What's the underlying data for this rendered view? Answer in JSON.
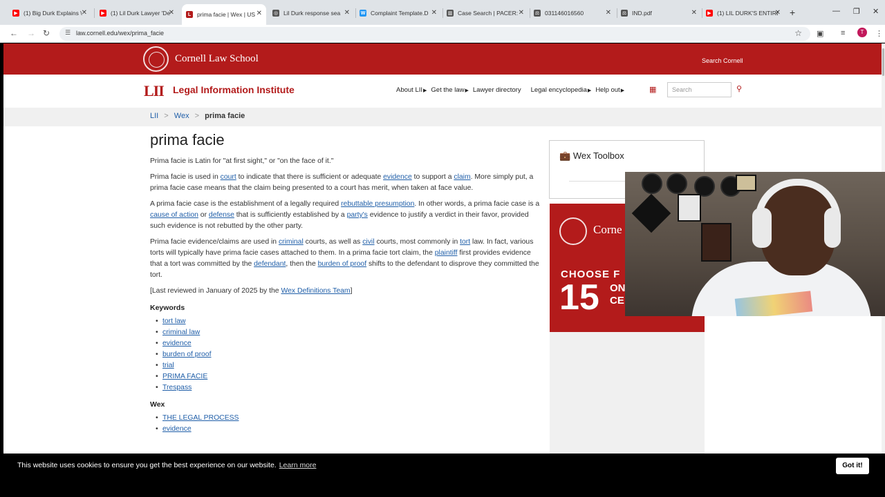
{
  "browser": {
    "tabs": [
      {
        "title": "(1) Big Durk Explains \\",
        "favicon_color": "#ff0000"
      },
      {
        "title": "(1) Lil Durk Lawyer 'De",
        "favicon_color": "#ff0000"
      },
      {
        "title": "prima facie | Wex | US",
        "favicon_color": "#b31b1b"
      },
      {
        "title": "Lil Durk response sea",
        "favicon_color": "#555555"
      },
      {
        "title": "Complaint Template.D",
        "favicon_color": "#2196f3"
      },
      {
        "title": "Case Search | PACER:",
        "favicon_color": "#555555"
      },
      {
        "title": "031146016560",
        "favicon_color": "#555555"
      },
      {
        "title": "IND.pdf",
        "favicon_color": "#555555"
      },
      {
        "title": "(1) LIL DURK'S ENTIRE",
        "favicon_color": "#ff0000"
      }
    ],
    "active_tab_index": 2,
    "url": "law.cornell.edu/wex/prima_facie",
    "profile_initial": "T"
  },
  "cornell": {
    "name": "Cornell Law School",
    "search_label": "Search Cornell"
  },
  "lii": {
    "logo": "LII",
    "title": "Legal Information Institute",
    "nav": [
      "About LII",
      "Get the law",
      "Lawyer directory",
      "Legal encyclopedia",
      "Help out"
    ],
    "search_placeholder": "Search"
  },
  "breadcrumb": {
    "items": [
      "LII",
      "Wex"
    ],
    "separator": ">",
    "current": "prima facie"
  },
  "article": {
    "title": "prima facie",
    "intro": "Prima facie is Latin for \"at first sight,\" or \"on the face of it.\"",
    "p2": {
      "t1": "Prima facie is used in ",
      "l1": "court",
      "t2": " to indicate that there is sufficient or adequate ",
      "l2": "evidence",
      "t3": " to support a ",
      "l3": "claim",
      "t4": ". More simply put, a prima facie case means that the claim being presented to a court has merit, when taken at face value."
    },
    "p3": {
      "t1": "A prima facie case is the establishment of a legally required ",
      "l1": "rebuttable presumption",
      "t2": ". In other words, a prima facie case is a ",
      "l2": "cause of action",
      "t3": " or ",
      "l3": "defense",
      "t4": " that is sufficiently established by a ",
      "l4": "party's",
      "t5": " evidence to justify a verdict in their favor, provided such evidence is not rebutted by the other party."
    },
    "p4": {
      "t1": "Prima facie evidence/claims are used in ",
      "l1": "criminal",
      "t2": " courts, as well as ",
      "l2": "civil",
      "t3": " courts, most commonly in ",
      "l3": "tort",
      "t4": " law. In fact, various torts will typically have prima facie cases attached to them. In a prima facie tort claim, the ",
      "l4": "plaintiff",
      "t5": " first provides evidence that a tort was committed by the ",
      "l5": "defendant",
      "t6": ", then the ",
      "l6": "burden of proof",
      "t7": " shifts to the defendant to disprove they committed the tort."
    },
    "review": {
      "t1": "[Last reviewed in January of 2025 by the ",
      "link": "Wex Definitions Team",
      "t2": "]"
    },
    "keywords_heading": "Keywords",
    "keywords": [
      "tort law",
      "criminal law",
      "evidence",
      "burden of proof",
      "trial",
      "PRIMA FACIE",
      "Trespass"
    ],
    "wex_heading": "Wex",
    "wex_links": [
      "THE LEGAL PROCESS",
      "evidence"
    ]
  },
  "sidebar": {
    "toolbox_title": "Wex Toolbox",
    "ad": {
      "brand": "Corne",
      "line1": "CHOOSE F",
      "number": "15",
      "side1": "ON",
      "side2": "CE"
    }
  },
  "cookie": {
    "message": "This website uses cookies to ensure you get the best experience on our website.",
    "learn_more": "Learn more",
    "button": "Got it!"
  }
}
